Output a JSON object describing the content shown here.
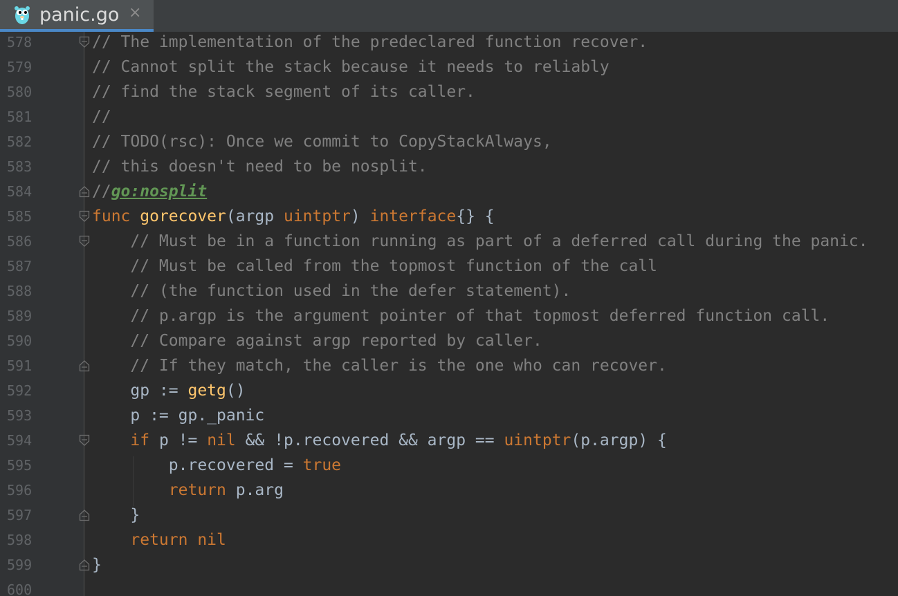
{
  "tab": {
    "title": "panic.go",
    "close_glyph": "×",
    "icon": "gopher-icon"
  },
  "colors": {
    "background": "#2b2b2b",
    "gutter": "#313335",
    "comment": "#808080",
    "keyword": "#cc7832",
    "function": "#ffc66d",
    "text": "#a9b7c6",
    "directive": "#629755",
    "line_number": "#606366",
    "tab_accent": "#4a88c7"
  },
  "lines": [
    {
      "number": "578",
      "fold": "open",
      "tokens": [
        {
          "t": "// The implementation of the predeclared function recover.",
          "c": "comment"
        }
      ]
    },
    {
      "number": "579",
      "fold": "",
      "tokens": [
        {
          "t": "// Cannot split the stack because it needs to reliably",
          "c": "comment"
        }
      ]
    },
    {
      "number": "580",
      "fold": "",
      "tokens": [
        {
          "t": "// find the stack segment of its caller.",
          "c": "comment"
        }
      ]
    },
    {
      "number": "581",
      "fold": "",
      "tokens": [
        {
          "t": "//",
          "c": "comment"
        }
      ]
    },
    {
      "number": "582",
      "fold": "",
      "tokens": [
        {
          "t": "// TODO(rsc): Once we commit to CopyStackAlways,",
          "c": "comment"
        }
      ]
    },
    {
      "number": "583",
      "fold": "",
      "tokens": [
        {
          "t": "// this doesn't need to be nosplit.",
          "c": "comment"
        }
      ]
    },
    {
      "number": "584",
      "fold": "close",
      "tokens": [
        {
          "t": "//",
          "c": "comment"
        },
        {
          "t": "go:nosplit",
          "c": "directive"
        }
      ]
    },
    {
      "number": "585",
      "fold": "open",
      "tokens": [
        {
          "t": "func ",
          "c": "kw"
        },
        {
          "t": "gorecover",
          "c": "fn"
        },
        {
          "t": "(argp ",
          "c": "text"
        },
        {
          "t": "uintptr",
          "c": "kw"
        },
        {
          "t": ") ",
          "c": "text"
        },
        {
          "t": "interface",
          "c": "kw"
        },
        {
          "t": "{} {",
          "c": "text"
        }
      ]
    },
    {
      "number": "586",
      "fold": "open",
      "tokens": [
        {
          "t": "    // Must be in a function running as part of a deferred call during the panic.",
          "c": "comment"
        }
      ]
    },
    {
      "number": "587",
      "fold": "",
      "tokens": [
        {
          "t": "    // Must be called from the topmost function of the call",
          "c": "comment"
        }
      ]
    },
    {
      "number": "588",
      "fold": "",
      "tokens": [
        {
          "t": "    // (the function used in the defer statement).",
          "c": "comment"
        }
      ]
    },
    {
      "number": "589",
      "fold": "",
      "tokens": [
        {
          "t": "    // p.argp is the argument pointer of that topmost deferred function call.",
          "c": "comment"
        }
      ]
    },
    {
      "number": "590",
      "fold": "",
      "tokens": [
        {
          "t": "    // Compare against argp reported by caller.",
          "c": "comment"
        }
      ]
    },
    {
      "number": "591",
      "fold": "close",
      "tokens": [
        {
          "t": "    // If they match, the caller is the one who can recover.",
          "c": "comment"
        }
      ]
    },
    {
      "number": "592",
      "fold": "",
      "tokens": [
        {
          "t": "    gp := ",
          "c": "text"
        },
        {
          "t": "getg",
          "c": "fn"
        },
        {
          "t": "()",
          "c": "text"
        }
      ]
    },
    {
      "number": "593",
      "fold": "",
      "tokens": [
        {
          "t": "    p := gp._panic",
          "c": "text"
        }
      ]
    },
    {
      "number": "594",
      "fold": "open",
      "tokens": [
        {
          "t": "    ",
          "c": "text"
        },
        {
          "t": "if ",
          "c": "kw"
        },
        {
          "t": "p != ",
          "c": "text"
        },
        {
          "t": "nil ",
          "c": "kw"
        },
        {
          "t": "&& !p.recovered && argp == ",
          "c": "text"
        },
        {
          "t": "uintptr",
          "c": "kw"
        },
        {
          "t": "(p.argp) {",
          "c": "text"
        }
      ]
    },
    {
      "number": "595",
      "fold": "",
      "tokens": [
        {
          "t": "        p.recovered = ",
          "c": "text"
        },
        {
          "t": "true",
          "c": "kw"
        }
      ]
    },
    {
      "number": "596",
      "fold": "",
      "tokens": [
        {
          "t": "        ",
          "c": "text"
        },
        {
          "t": "return ",
          "c": "kw"
        },
        {
          "t": "p.arg",
          "c": "text"
        }
      ]
    },
    {
      "number": "597",
      "fold": "close",
      "tokens": [
        {
          "t": "    }",
          "c": "text"
        }
      ]
    },
    {
      "number": "598",
      "fold": "",
      "tokens": [
        {
          "t": "    ",
          "c": "text"
        },
        {
          "t": "return nil",
          "c": "kw"
        }
      ]
    },
    {
      "number": "599",
      "fold": "close",
      "tokens": [
        {
          "t": "}",
          "c": "text"
        }
      ]
    },
    {
      "number": "600",
      "fold": "",
      "tokens": []
    }
  ]
}
